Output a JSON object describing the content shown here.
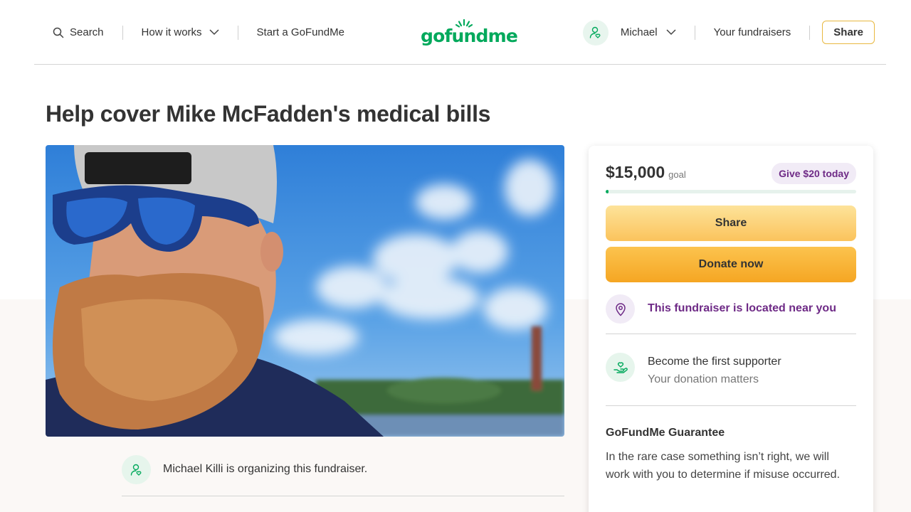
{
  "header": {
    "search_label": "Search",
    "how_it_works_label": "How it works",
    "start_label": "Start a GoFundMe",
    "logo_text": "gofundme",
    "user_name": "Michael",
    "your_fundraisers_label": "Your fundraisers",
    "share_label": "Share"
  },
  "page": {
    "title": "Help cover Mike McFadden's medical bills"
  },
  "organizer": {
    "text": "Michael Killi is organizing this fundraiser."
  },
  "donation_card": {
    "goal_amount": "$15,000",
    "goal_label": "goal",
    "give_pill": "Give $20 today",
    "progress_fraction": 0.01,
    "share_label": "Share",
    "donate_label": "Donate now",
    "location_text": "This fundraiser is located near you",
    "supporter_title": "Become the first supporter",
    "supporter_subtitle": "Your donation matters",
    "guarantee_title": "GoFundMe Guarantee",
    "guarantee_text": "In the rare case something isn’t right, we will work with you to determine if misuse occurred."
  },
  "icons": {
    "search": "search-icon",
    "chevron": "chevron-down-icon",
    "user": "user-icon",
    "location": "location-pin-icon",
    "heart_hand": "heart-hand-icon"
  },
  "colors": {
    "brand_green": "#02a95c",
    "accent_purple": "#6e2a86",
    "donate_orange": "#f5a623",
    "share_yellow": "#fbc35c"
  }
}
